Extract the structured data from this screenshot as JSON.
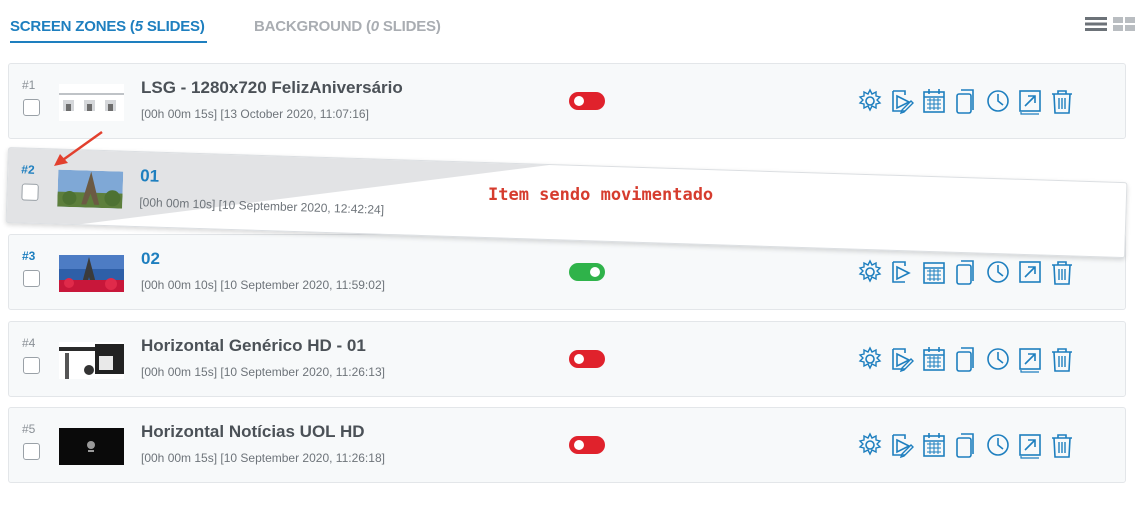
{
  "tabs": {
    "screen_zones_prefix": "SCREEN ZONES (",
    "screen_zones_count": "5",
    "screen_zones_suffix": " SLIDES)",
    "background_prefix": "BACKGROUND (",
    "background_count": "0",
    "background_suffix": " SLIDES)"
  },
  "view_toggle": {
    "list_icon": "list-view-icon",
    "grid_icon": "grid-view-icon"
  },
  "colors": {
    "accent": "#1e7fbf",
    "toggle_off": "#e0222c",
    "toggle_on": "#2fb34a",
    "annotation": "#d63c2e"
  },
  "annotation": {
    "label": "Item sendo movimentado"
  },
  "slides": [
    {
      "index": "#1",
      "title": "LSG - 1280x720 FelizAniversário",
      "meta": "[00h 00m 15s] [13 October 2020, 11:07:16]",
      "enabled": false
    },
    {
      "index": "#2",
      "title": "01",
      "meta": "[00h 00m 10s] [10 September 2020, 12:42:24]",
      "enabled": true
    },
    {
      "index": "#3",
      "title": "02",
      "meta": "[00h 00m 10s] [10 September 2020, 11:59:02]",
      "enabled": true
    },
    {
      "index": "#4",
      "title": "Horizontal Genérico HD - 01",
      "meta": "[00h 00m 15s] [10 September 2020, 11:26:13]",
      "enabled": false
    },
    {
      "index": "#5",
      "title": "Horizontal Notícias UOL HD",
      "meta": "[00h 00m 15s] [10 September 2020, 11:26:18]",
      "enabled": false
    }
  ],
  "action_icons": [
    "settings-icon",
    "edit-icon",
    "schedule-icon",
    "duplicate-icon",
    "clock-icon",
    "open-external-icon",
    "trash-icon"
  ]
}
